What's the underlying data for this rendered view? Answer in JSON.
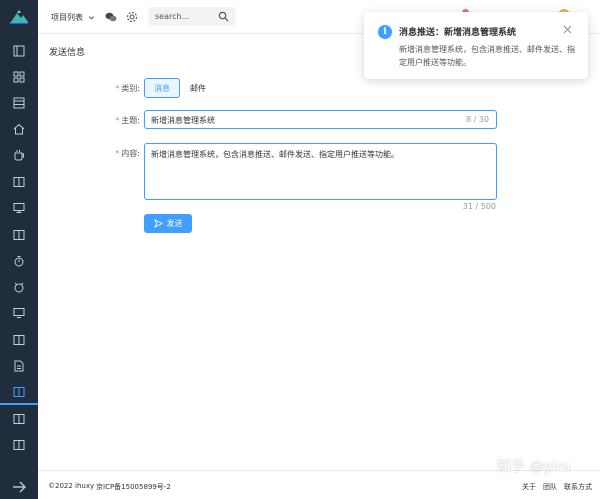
{
  "header": {
    "project_label": "项目列表",
    "search_placeholder": "search..."
  },
  "page": {
    "title": "发送信息",
    "type_label": "类别:",
    "type_options": [
      "消息",
      "邮件"
    ],
    "subject_label": "主题:",
    "subject_value": "新增消息管理系统",
    "subject_count": "8 / 30",
    "content_label": "内容:",
    "content_value": "新增消息管理系统，包含消息推送、邮件发送、指定用户推送等功能。",
    "content_count": "31 / 500",
    "send_label": "发送"
  },
  "notification": {
    "title": "消息推送：新增消息管理系统",
    "text": "新增消息管理系统，包含消息推送、邮件发送、指定用户推送等功能。"
  },
  "footer": {
    "copyright": "©2022 ihuxy",
    "icp": "京ICP备15005899号-2",
    "links": [
      "关于",
      "团队",
      "联系方式"
    ]
  },
  "watermark": "知乎 @yiru",
  "colors": {
    "primary": "#409eff",
    "sidebar": "#1f2d3d",
    "danger": "#f56c6c"
  }
}
